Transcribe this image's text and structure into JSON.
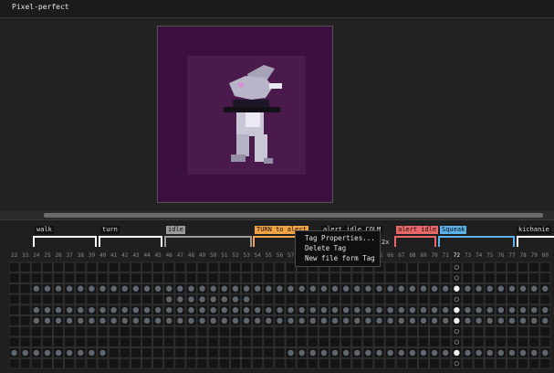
{
  "window": {
    "title": "Pixel-perfect"
  },
  "timeline": {
    "tags": [
      {
        "label": "walk",
        "color": "#ffffff"
      },
      {
        "label": "turn",
        "color": "#ffffff"
      },
      {
        "label": "idle",
        "color": "#9a9a9a"
      },
      {
        "label": "TURN to alert",
        "color": "#f2a445"
      },
      {
        "label": "alert idle COLM",
        "color": "#ffffff"
      },
      {
        "label": "alert idle",
        "color": "#e96767"
      },
      {
        "label": "Squeak",
        "color": "#5bb1e9"
      },
      {
        "label": "kichanie",
        "color": "#ffffff"
      }
    ],
    "frame_numbers": [
      "22",
      "33",
      "24",
      "25",
      "26",
      "37",
      "38",
      "39",
      "40",
      "41",
      "42",
      "43",
      "44",
      "45",
      "46",
      "47",
      "48",
      "49",
      "50",
      "51",
      "52",
      "53",
      "54",
      "55",
      "56",
      "57",
      "58",
      "59",
      "60",
      "61",
      "62",
      "63",
      "64",
      "65",
      "66",
      "67",
      "68",
      "69",
      "70",
      "71",
      "72",
      "73",
      "74",
      "75",
      "76",
      "77",
      "78",
      "79",
      "80"
    ],
    "current_frame": "72",
    "partial_label": "2x"
  },
  "context_menu": {
    "items": [
      "Tag Properties...",
      "Delete Tag",
      "New file form Tag"
    ]
  }
}
